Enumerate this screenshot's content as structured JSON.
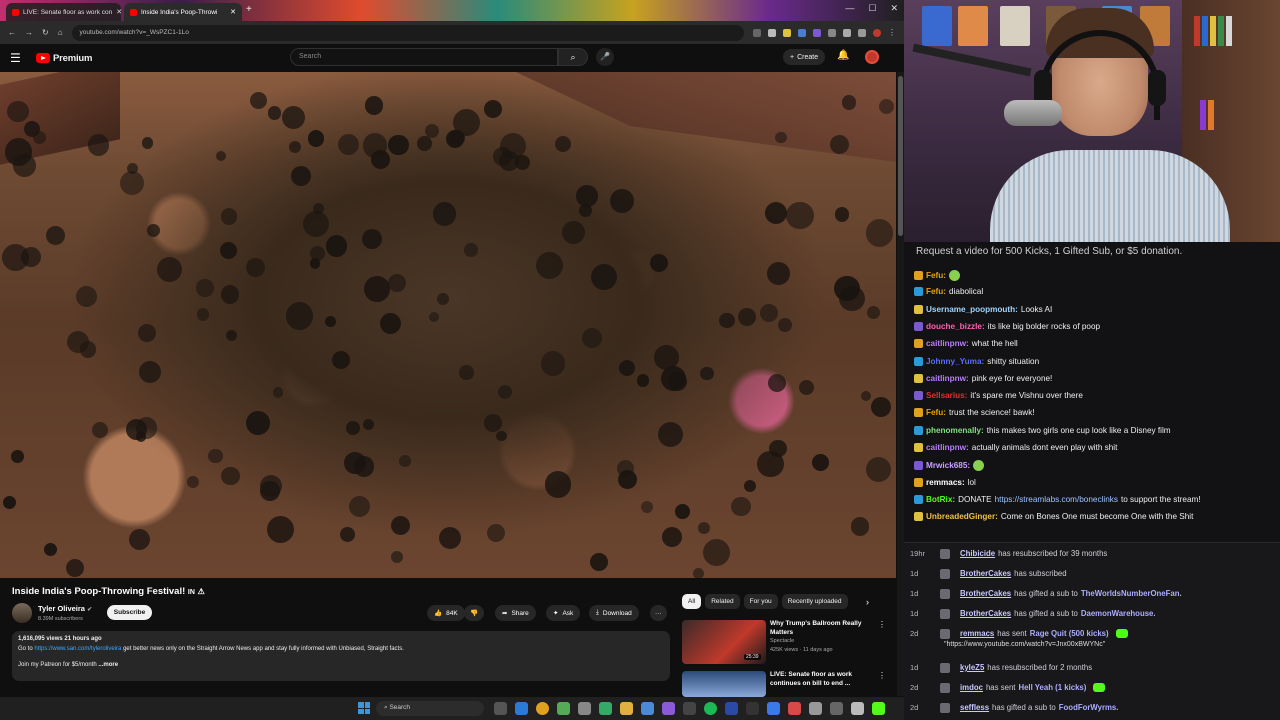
{
  "browser": {
    "tabs": [
      {
        "label": "LIVE: Senate floor as work con"
      },
      {
        "label": "Inside India's Poop-Throwi"
      }
    ],
    "new_tab": "+",
    "url": "youtube.com/watch?v=_WsPZC1-1Lo",
    "window_controls": [
      "—",
      "☐",
      "✕"
    ]
  },
  "youtube": {
    "logo": "Premium",
    "search_placeholder": "Search",
    "create_label": "Create",
    "video": {
      "title": "Inside India's Poop-Throwing Festival!",
      "title_tag": "IN",
      "channel": "Tyler Oliveira",
      "subscribers": "8.39M subscribers",
      "subscribe_label": "Subscribe",
      "likes": "84K",
      "share_label": "Share",
      "ask_label": "Ask",
      "download_label": "Download",
      "more_label": "···",
      "description": {
        "meta": "1,616,095 views  21 hours ago",
        "line1_prefix": "Go to",
        "line1_link": "https://www.san.com/tyleroliveira",
        "line1_suffix": "get better news only on the Straight Arrow News app and stay fully informed with Unbiased, Straight facts.",
        "line2": "Join my Patreon for $5/month",
        "more": "...more"
      }
    },
    "chips": [
      "All",
      "Related",
      "For you",
      "Recently uploaded"
    ],
    "recommendations": [
      {
        "title": "Why Trump's Ballroom Really Matters",
        "channel": "Spectacle",
        "meta": "425K views · 11 days ago",
        "duration": "25:39"
      },
      {
        "title": "LIVE: Senate floor as work continues on bill to end ...",
        "channel": "",
        "meta": "",
        "duration": ""
      }
    ]
  },
  "taskbar": {
    "search_placeholder": "Search"
  },
  "chat": {
    "header": "Request a video for 500 Kicks, 1 Gifted Sub, or $5 donation.",
    "messages": [
      {
        "user": "Fefu:",
        "text": "",
        "color": "#e8a000"
      },
      {
        "user": "Fefu:",
        "text": "diabolical",
        "color": "#e8a000"
      },
      {
        "user": "Username_poopmouth:",
        "text": "Looks AI",
        "color": "#9fd4ff"
      },
      {
        "user": "douche_bizzle:",
        "text": "its like big bolder rocks of poop",
        "color": "#ff5fb0"
      },
      {
        "user": "caitlinpnw:",
        "text": "what the hell",
        "color": "#b77dff"
      },
      {
        "user": "Johnny_Yuma:",
        "text": "shitty situation",
        "color": "#5b6bff"
      },
      {
        "user": "caitlinpnw:",
        "text": "pink eye for everyone!",
        "color": "#b77dff"
      },
      {
        "user": "Sellsarius:",
        "text": "it's spare me Vishnu over there",
        "color": "#e03030"
      },
      {
        "user": "Fefu:",
        "text": "trust the science! bawk!",
        "color": "#e8a000"
      },
      {
        "user": "phenomenally:",
        "text": "this makes two girls one cup look like a Disney film",
        "color": "#7fe07f"
      },
      {
        "user": "caitlinpnw:",
        "text": "actually animals dont even play with shit",
        "color": "#b77dff"
      },
      {
        "user": "Mrwick685:",
        "text": "",
        "color": "#c9a0ff"
      },
      {
        "user": "remmacs:",
        "text": "lol",
        "color": "#ffffff"
      },
      {
        "user": "BotRix:",
        "text": "DONATE",
        "link": "https://streamlabs.com/boneclinks",
        "suffix": "to support the stream!",
        "color": "#53fc18"
      },
      {
        "user": "UnbreadedGinger:",
        "text": "Come on Bones One must become One with the Shit",
        "color": "#f0c040"
      }
    ]
  },
  "events": [
    {
      "time": "19hr",
      "name": "Chibicide",
      "text": "has resubscribed for 39 months"
    },
    {
      "time": "1d",
      "name": "BrotherCakes",
      "text": "has subscribed"
    },
    {
      "time": "1d",
      "name": "BrotherCakes",
      "text": "has gifted a sub to",
      "target": "TheWorldsNumberOneFan."
    },
    {
      "time": "1d",
      "name": "BrotherCakes",
      "text": "has gifted a sub to",
      "target": "DaemonWarehouse."
    },
    {
      "time": "2d",
      "name": "remmacs",
      "text": "has sent",
      "target": "Rage Quit (500 kicks)",
      "sub": "\"https://www.youtube.com/watch?v=Jnx00xBWYNc\""
    },
    {
      "time": "1d",
      "name": "kyleZ5",
      "text": "has resubscribed for 2 months"
    },
    {
      "time": "2d",
      "name": "imdoc",
      "text": "has sent",
      "target": "Hell Yeah (1 kicks)"
    },
    {
      "time": "2d",
      "name": "seffless",
      "text": "has gifted a sub to",
      "target": "FoodForWyrms."
    }
  ],
  "colors": {
    "accent": "#ff0000",
    "kick": "#53fc18",
    "link": "#3ea6ff"
  }
}
